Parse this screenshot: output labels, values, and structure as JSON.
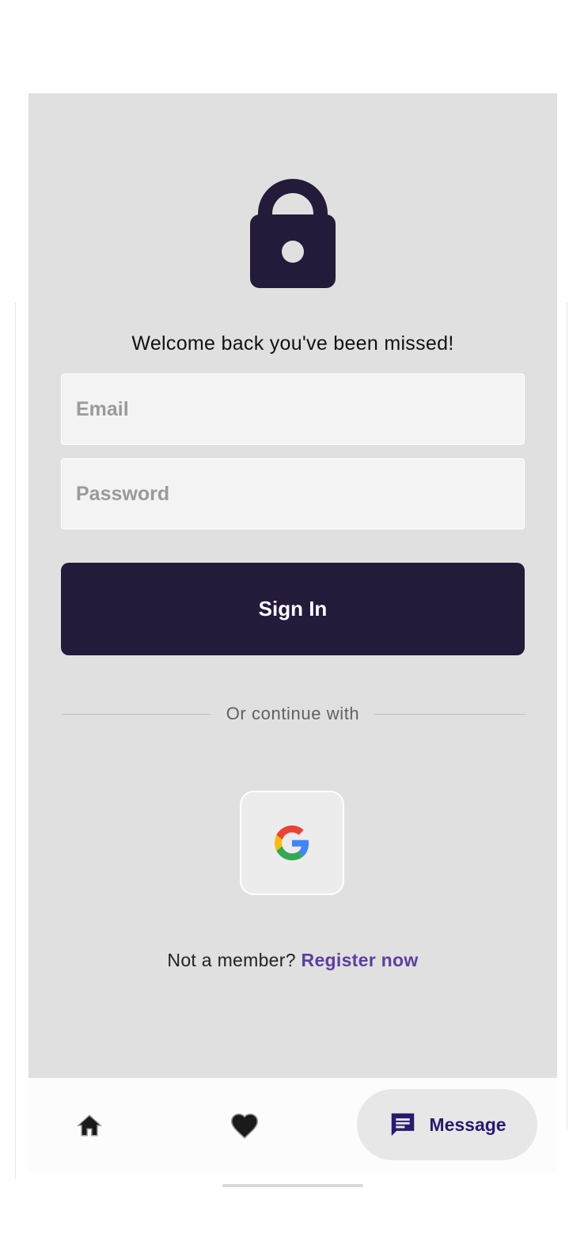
{
  "login": {
    "welcome_text": "Welcome back you've been missed!",
    "email_placeholder": "Email",
    "password_placeholder": "Password",
    "signin_label": "Sign In",
    "divider_text": "Or continue with",
    "social_provider_icon": "google-icon",
    "register_prompt": "Not a member?",
    "register_link": "Register now"
  },
  "bottom_nav": {
    "items": [
      {
        "icon": "home-icon"
      },
      {
        "icon": "heart-icon"
      }
    ],
    "fab": {
      "icon": "message-icon",
      "label": "Message"
    }
  },
  "colors": {
    "screen_background": "#e0e0e0",
    "primary_dark": "#241a3a",
    "link_purple": "#5e3e9e",
    "fab_label": "#2a1a6e"
  }
}
